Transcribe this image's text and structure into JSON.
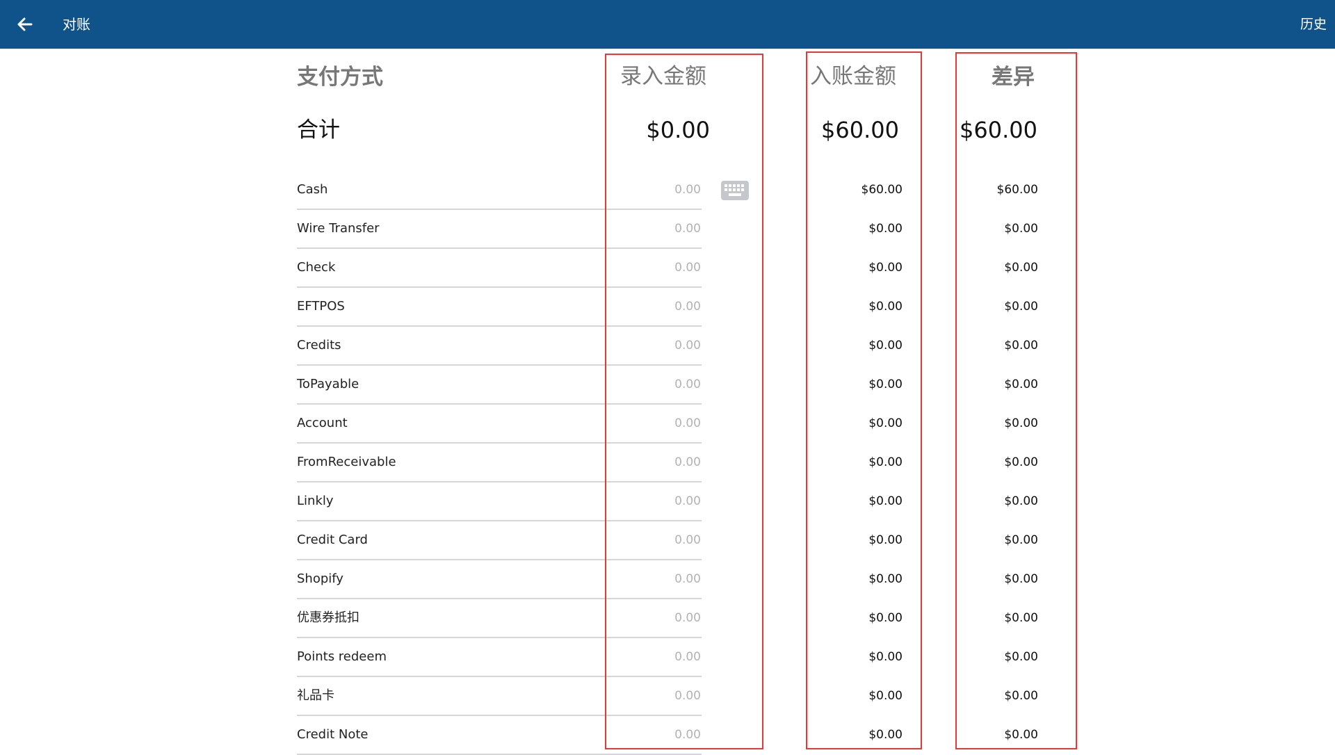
{
  "appbar": {
    "title": "对账",
    "history_label": "历史",
    "back_icon": "arrow-left-icon",
    "background": "#0f538a"
  },
  "headers": {
    "payment_method": "支付方式",
    "entered_amount": "录入金额",
    "posted_amount": "入账金额",
    "difference": "差异"
  },
  "total": {
    "label": "合计",
    "entered": "$0.00",
    "posted": "$60.00",
    "difference": "$60.00"
  },
  "input_placeholder": "0.00",
  "keyboard_icon": "keyboard-icon",
  "highlight_color": "#e53935",
  "rows": [
    {
      "method": "Cash",
      "posted": "$60.00",
      "difference": "$60.00"
    },
    {
      "method": "Wire Transfer",
      "posted": "$0.00",
      "difference": "$0.00"
    },
    {
      "method": "Check",
      "posted": "$0.00",
      "difference": "$0.00"
    },
    {
      "method": "EFTPOS",
      "posted": "$0.00",
      "difference": "$0.00"
    },
    {
      "method": "Credits",
      "posted": "$0.00",
      "difference": "$0.00"
    },
    {
      "method": "ToPayable",
      "posted": "$0.00",
      "difference": "$0.00"
    },
    {
      "method": "Account",
      "posted": "$0.00",
      "difference": "$0.00"
    },
    {
      "method": "FromReceivable",
      "posted": "$0.00",
      "difference": "$0.00"
    },
    {
      "method": "Linkly",
      "posted": "$0.00",
      "difference": "$0.00"
    },
    {
      "method": "Credit Card",
      "posted": "$0.00",
      "difference": "$0.00"
    },
    {
      "method": "Shopify",
      "posted": "$0.00",
      "difference": "$0.00"
    },
    {
      "method": "优惠券抵扣",
      "posted": "$0.00",
      "difference": "$0.00"
    },
    {
      "method": "Points redeem",
      "posted": "$0.00",
      "difference": "$0.00"
    },
    {
      "method": "礼品卡",
      "posted": "$0.00",
      "difference": "$0.00"
    },
    {
      "method": "Credit Note",
      "posted": "$0.00",
      "difference": "$0.00"
    }
  ]
}
